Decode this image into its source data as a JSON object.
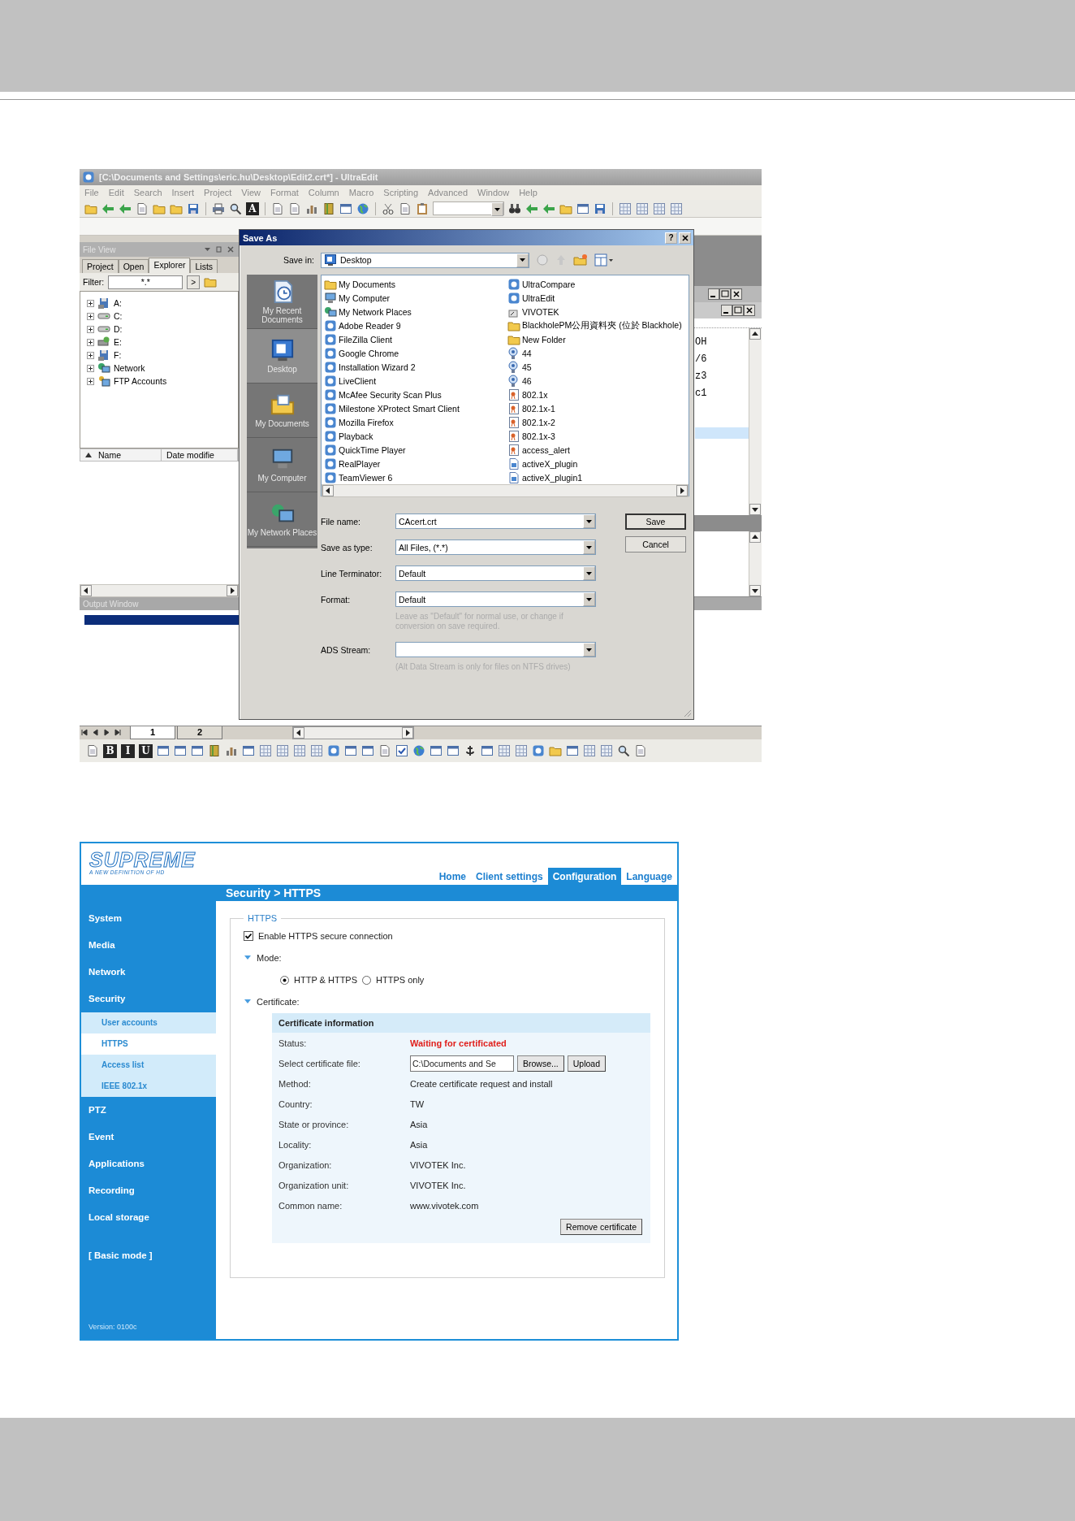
{
  "editor": {
    "title": "[C:\\Documents and Settings\\eric.hu\\Desktop\\Edit2.crt*] - UltraEdit",
    "menu": [
      "File",
      "Edit",
      "Search",
      "Insert",
      "Project",
      "View",
      "Format",
      "Column",
      "Macro",
      "Scripting",
      "Advanced",
      "Window",
      "Help"
    ],
    "toolbar_letter": "A",
    "file_view": {
      "title": "File View",
      "tabs": [
        {
          "label": "Project",
          "selected": false
        },
        {
          "label": "Open",
          "selected": false
        },
        {
          "label": "Explorer",
          "selected": true
        },
        {
          "label": "Lists",
          "selected": false
        }
      ],
      "filter_label": "Filter:",
      "filter_value": "*.*",
      "filter_button": ">",
      "tree": [
        {
          "label": "A:",
          "kind": "floppy",
          "expanded": false
        },
        {
          "label": "C:",
          "kind": "drive",
          "expanded": false
        },
        {
          "label": "D:",
          "kind": "drive",
          "expanded": false
        },
        {
          "label": "E:",
          "kind": "removable",
          "expanded": false
        },
        {
          "label": "F:",
          "kind": "floppy",
          "expanded": false
        },
        {
          "label": "Network",
          "kind": "network",
          "expanded": false
        },
        {
          "label": "FTP Accounts",
          "kind": "ftp",
          "expanded": false
        }
      ],
      "columns": [
        "Name",
        "Date modifie"
      ]
    },
    "editor_lines": [
      "OH",
      "/6",
      "z3",
      "c1"
    ],
    "output_window": {
      "title": "Output Window"
    },
    "sheet_tabs": [
      {
        "label": "1",
        "selected": true
      },
      {
        "label": "2",
        "selected": false
      }
    ],
    "format_buttons": [
      "B",
      "I",
      "U"
    ]
  },
  "save_dialog": {
    "title": "Save As",
    "help_button": "?",
    "save_in_label": "Save in:",
    "save_in_value": "Desktop",
    "places": [
      {
        "label": "My Recent Documents",
        "kind": "recent",
        "selected": false
      },
      {
        "label": "Desktop",
        "kind": "desktop",
        "selected": true
      },
      {
        "label": "My Documents",
        "kind": "documents",
        "selected": false
      },
      {
        "label": "My Computer",
        "kind": "computer",
        "selected": false
      },
      {
        "label": "My Network Places",
        "kind": "network",
        "selected": false
      }
    ],
    "files": [
      {
        "label": "My Documents",
        "kind": "folder"
      },
      {
        "label": "My Computer",
        "kind": "computer"
      },
      {
        "label": "My Network Places",
        "kind": "network"
      },
      {
        "label": "Adobe Reader 9",
        "kind": "app"
      },
      {
        "label": "FileZilla Client",
        "kind": "app"
      },
      {
        "label": "Google Chrome",
        "kind": "app"
      },
      {
        "label": "Installation Wizard 2",
        "kind": "app"
      },
      {
        "label": "LiveClient",
        "kind": "app"
      },
      {
        "label": "McAfee Security Scan Plus",
        "kind": "app"
      },
      {
        "label": "Milestone XProtect Smart Client",
        "kind": "app"
      },
      {
        "label": "Mozilla Firefox",
        "kind": "app"
      },
      {
        "label": "Playback",
        "kind": "app"
      },
      {
        "label": "QuickTime Player",
        "kind": "app"
      },
      {
        "label": "RealPlayer",
        "kind": "app"
      },
      {
        "label": "TeamViewer 6",
        "kind": "app"
      },
      {
        "label": "UltraCompare",
        "kind": "app"
      },
      {
        "label": "UltraEdit",
        "kind": "app"
      },
      {
        "label": "VIVOTEK",
        "kind": "shortcut"
      },
      {
        "label": "BlackholePM公用資料夾 (位於 Blackhole)",
        "kind": "folder"
      },
      {
        "label": "New Folder",
        "kind": "folder"
      },
      {
        "label": "44",
        "kind": "camera"
      },
      {
        "label": "45",
        "kind": "camera"
      },
      {
        "label": "46",
        "kind": "camera"
      },
      {
        "label": "802.1x",
        "kind": "certificate"
      },
      {
        "label": "802.1x-1",
        "kind": "certificate"
      },
      {
        "label": "802.1x-2",
        "kind": "certificate"
      },
      {
        "label": "802.1x-3",
        "kind": "certificate"
      },
      {
        "label": "access_alert",
        "kind": "certificate"
      },
      {
        "label": "activeX_plugin",
        "kind": "file"
      },
      {
        "label": "activeX_plugin1",
        "kind": "file"
      }
    ],
    "fields": [
      {
        "label": "File name:",
        "value": "CAcert.crt"
      },
      {
        "label": "Save as type:",
        "value": "All Files, (*.*)"
      },
      {
        "label": "Line Terminator:",
        "value": "Default"
      },
      {
        "label": "Format:",
        "value": "Default",
        "hint": "Leave as \"Default\" for normal use, or change if conversion on save required."
      },
      {
        "label": "ADS Stream:",
        "hint": "(Alt Data Stream is only for files on NTFS drives)"
      }
    ],
    "buttons": [
      {
        "label": "Save",
        "default": true
      },
      {
        "label": "Cancel",
        "default": false
      }
    ]
  },
  "web_ui": {
    "logo": "SUPREME",
    "tagline": "A NEW DEFINITION OF HD",
    "nav": [
      {
        "label": "Home",
        "selected": false
      },
      {
        "label": "Client settings",
        "selected": false
      },
      {
        "label": "Configuration",
        "selected": true
      },
      {
        "label": "Language",
        "selected": false
      }
    ],
    "breadcrumb": "Security > HTTPS",
    "sidebar": [
      {
        "label": "System",
        "kind": "section",
        "selected": false
      },
      {
        "label": "Media",
        "kind": "section",
        "selected": false
      },
      {
        "label": "Network",
        "kind": "section",
        "selected": false
      },
      {
        "label": "Security",
        "kind": "section",
        "selected": false
      },
      {
        "label": "User accounts",
        "kind": "sub",
        "selected": false
      },
      {
        "label": "HTTPS",
        "kind": "sub",
        "selected": true
      },
      {
        "label": "Access list",
        "kind": "sub",
        "selected": false
      },
      {
        "label": "IEEE 802.1x",
        "kind": "sub",
        "selected": false
      },
      {
        "label": "PTZ",
        "kind": "section",
        "selected": false
      },
      {
        "label": "Event",
        "kind": "section",
        "selected": false
      },
      {
        "label": "Applications",
        "kind": "section",
        "selected": false
      },
      {
        "label": "Recording",
        "kind": "section",
        "selected": false
      },
      {
        "label": "Local storage",
        "kind": "section",
        "selected": false
      },
      {
        "label": "[ Basic mode ]",
        "kind": "mode",
        "selected": false
      }
    ],
    "version": "Version: 0100c",
    "fieldset_title": "HTTPS",
    "enable": {
      "label": "Enable HTTPS secure connection",
      "checked": true
    },
    "mode": {
      "label": "Mode:",
      "expanded": true,
      "options": [
        {
          "label": "HTTP & HTTPS",
          "selected": true
        },
        {
          "label": "HTTPS only",
          "selected": false
        }
      ]
    },
    "certificate": {
      "label": "Certificate:",
      "expanded": true,
      "title": "Certificate information",
      "rows": [
        {
          "label": "Status:",
          "kind": "alert",
          "value": "Waiting for certificated"
        },
        {
          "label": "Select certificate file:",
          "kind": "file",
          "value": "C:\\Documents and Se",
          "buttons": [
            "Browse...",
            "Upload"
          ]
        },
        {
          "label": "Method:",
          "kind": "text",
          "value": "Create certificate request and install"
        },
        {
          "label": "Country:",
          "kind": "text",
          "value": "TW"
        },
        {
          "label": "State or province:",
          "kind": "text",
          "value": "Asia"
        },
        {
          "label": "Locality:",
          "kind": "text",
          "value": "Asia"
        },
        {
          "label": "Organization:",
          "kind": "text",
          "value": "VIVOTEK Inc."
        },
        {
          "label": "Organization unit:",
          "kind": "text",
          "value": "VIVOTEK Inc."
        },
        {
          "label": "Common name:",
          "kind": "text",
          "value": "www.vivotek.com"
        }
      ],
      "remove_button": "Remove certificate"
    }
  }
}
